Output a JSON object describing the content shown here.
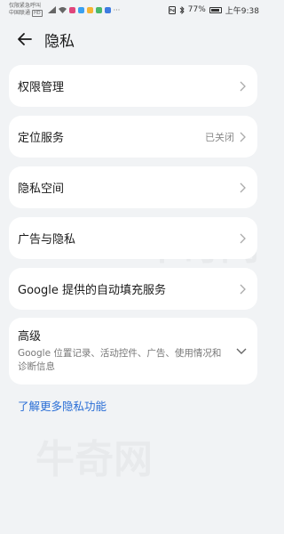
{
  "status_bar": {
    "carrier_line1": "仅限紧急呼叫",
    "carrier_line2": "中国联通",
    "hd": "HD",
    "battery": "77%",
    "time": "上午9:38"
  },
  "header": {
    "title": "隐私",
    "back_icon": "arrow-left-icon"
  },
  "items": [
    {
      "label": "权限管理",
      "status": ""
    },
    {
      "label": "定位服务",
      "status": "已关闭"
    },
    {
      "label": "隐私空间",
      "status": ""
    },
    {
      "label": "广告与隐私",
      "status": ""
    },
    {
      "label": "Google 提供的自动填充服务",
      "status": ""
    }
  ],
  "advanced": {
    "title": "高级",
    "subtitle": "Google 位置记录、活动控件、广告、使用情况和诊断信息"
  },
  "learn_more": "了解更多隐私功能",
  "colors": {
    "background": "#f1f3f5",
    "card": "#ffffff",
    "link": "#2b6fd6"
  },
  "watermark_text": "牛奇网"
}
